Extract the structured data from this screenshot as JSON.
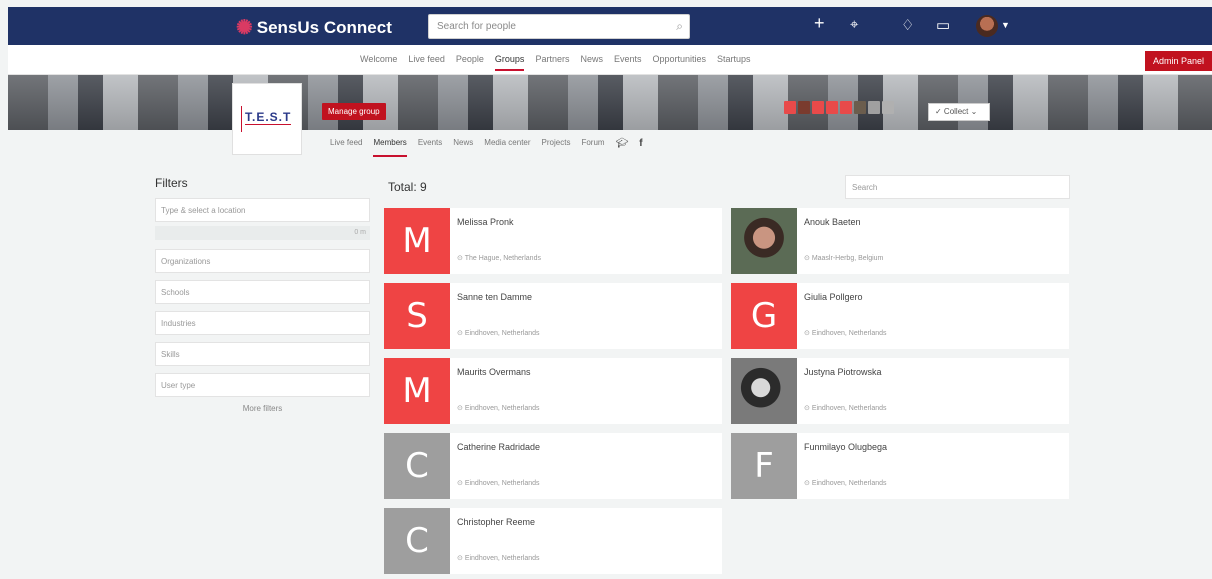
{
  "topbar": {
    "logo_text": "SensUs Connect",
    "search_placeholder": "Search for people",
    "icons": [
      "plus-icon",
      "map-pin-icon",
      "bell-icon",
      "chat-icon",
      "avatar-icon",
      "chevron-down-icon"
    ]
  },
  "mainnav": {
    "items": [
      "Welcome",
      "Live feed",
      "People",
      "Groups",
      "Partners",
      "News",
      "Events",
      "Opportunities",
      "Startups"
    ],
    "active": "Groups",
    "admin_label": "Admin Panel"
  },
  "group": {
    "logo_text": "T.E.S.T",
    "manage_label": "Manage group",
    "collect_label": "✓ Collect ⌄",
    "tabs": [
      "Live feed",
      "Members",
      "Events",
      "News",
      "Media center",
      "Projects",
      "Forum"
    ],
    "active_tab": "Members",
    "member_colors": [
      "#e84a4a",
      "#7a3b2e",
      "#e84a4a",
      "#e84a4a",
      "#e84a4a",
      "#6b5d4d",
      "#a0a0a0",
      "#b0b0b0"
    ]
  },
  "filters": {
    "title": "Filters",
    "location_placeholder": "Type & select a location",
    "range_label": "0 m",
    "fields": [
      "Organizations",
      "Schools",
      "Industries",
      "Skills",
      "User type"
    ],
    "more": "More filters"
  },
  "members": {
    "total_label": "Total: 9",
    "search_placeholder": "Search",
    "list": [
      {
        "name": "Melissa Pronk",
        "location": "The Hague, Netherlands",
        "initial": "M",
        "color": "#ef4444",
        "photo": false
      },
      {
        "name": "Anouk Baeten",
        "location": "Maaslr-Herbg, Belgium",
        "initial": "",
        "color": "",
        "photo": true
      },
      {
        "name": "Sanne ten Damme",
        "location": "Eindhoven, Netherlands",
        "initial": "S",
        "color": "#ef4444",
        "photo": false
      },
      {
        "name": "Giulia Pollgero",
        "location": "Eindhoven, Netherlands",
        "initial": "G",
        "color": "#ef4444",
        "photo": false
      },
      {
        "name": "Maurits Overmans",
        "location": "Eindhoven, Netherlands",
        "initial": "M",
        "color": "#ef4444",
        "photo": false
      },
      {
        "name": "Justyna Piotrowska",
        "location": "Eindhoven, Netherlands",
        "initial": "",
        "color": "",
        "photo": true
      },
      {
        "name": "Catherine Radridade",
        "location": "Eindhoven, Netherlands",
        "initial": "C",
        "color": "#9e9e9e",
        "photo": false
      },
      {
        "name": "Funmilayo Olugbega",
        "location": "Eindhoven, Netherlands",
        "initial": "F",
        "color": "#9e9e9e",
        "photo": false
      },
      {
        "name": "Christopher Reeme",
        "location": "Eindhoven, Netherlands",
        "initial": "C",
        "color": "#9e9e9e",
        "photo": false
      }
    ]
  }
}
